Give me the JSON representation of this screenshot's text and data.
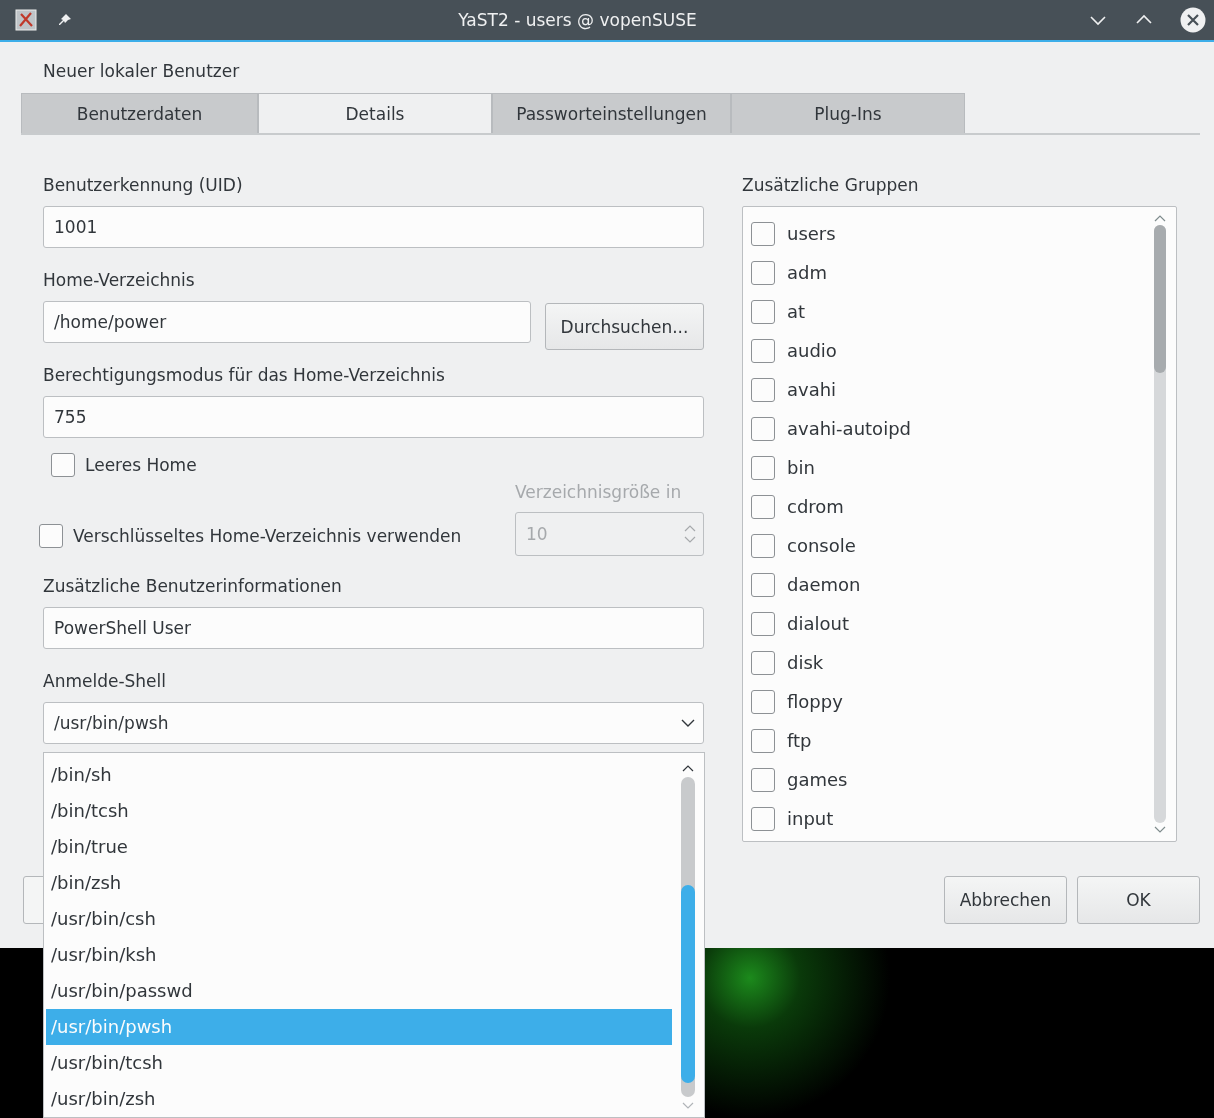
{
  "window": {
    "title": "YaST2 - users @ vopenSUSE"
  },
  "dialog_title": "Neuer lokaler Benutzer",
  "tabs": [
    {
      "label": "Benutzerdaten",
      "selected": false
    },
    {
      "label": "Details",
      "selected": true
    },
    {
      "label": "Passworteinstellungen",
      "selected": false
    },
    {
      "label": "Plug-Ins",
      "selected": false
    }
  ],
  "uid": {
    "label": "Benutzerkennung (UID)",
    "value": "1001"
  },
  "home": {
    "label": "Home-Verzeichnis",
    "value": "/home/power",
    "button": "Durchsuchen..."
  },
  "permission": {
    "label": "Berechtigungsmodus für das Home-Verzeichnis",
    "value": "755"
  },
  "empty_home": {
    "label": "Leeres Home",
    "checked": false
  },
  "dir_size": {
    "label": "Verzeichnisgröße in",
    "value": "10",
    "disabled": true
  },
  "encrypted_home": {
    "label": "Verschlüsseltes Home-Verzeichnis verwenden",
    "checked": false
  },
  "extra_info": {
    "label": "Zusätzliche Benutzerinformationen",
    "value": "PowerShell User"
  },
  "login_shell": {
    "label": "Anmelde-Shell",
    "value": "/usr/bin/pwsh",
    "expanded": true,
    "options": [
      {
        "label": "/bin/sh",
        "selected": false
      },
      {
        "label": "/bin/tcsh",
        "selected": false
      },
      {
        "label": "/bin/true",
        "selected": false
      },
      {
        "label": "/bin/zsh",
        "selected": false
      },
      {
        "label": "/usr/bin/csh",
        "selected": false
      },
      {
        "label": "/usr/bin/ksh",
        "selected": false
      },
      {
        "label": "/usr/bin/passwd",
        "selected": false
      },
      {
        "label": "/usr/bin/pwsh",
        "selected": true
      },
      {
        "label": "/usr/bin/tcsh",
        "selected": false
      },
      {
        "label": "/usr/bin/zsh",
        "selected": false
      }
    ]
  },
  "groups": {
    "label": "Zusätzliche Gruppen",
    "items": [
      {
        "label": "users",
        "checked": false
      },
      {
        "label": "adm",
        "checked": false
      },
      {
        "label": "at",
        "checked": false
      },
      {
        "label": "audio",
        "checked": false
      },
      {
        "label": "avahi",
        "checked": false
      },
      {
        "label": "avahi-autoipd",
        "checked": false
      },
      {
        "label": "bin",
        "checked": false
      },
      {
        "label": "cdrom",
        "checked": false
      },
      {
        "label": "console",
        "checked": false
      },
      {
        "label": "daemon",
        "checked": false
      },
      {
        "label": "dialout",
        "checked": false
      },
      {
        "label": "disk",
        "checked": false
      },
      {
        "label": "floppy",
        "checked": false
      },
      {
        "label": "ftp",
        "checked": false
      },
      {
        "label": "games",
        "checked": false
      },
      {
        "label": "input",
        "checked": false
      }
    ]
  },
  "buttons": [
    "Abbrechen",
    "OK"
  ]
}
